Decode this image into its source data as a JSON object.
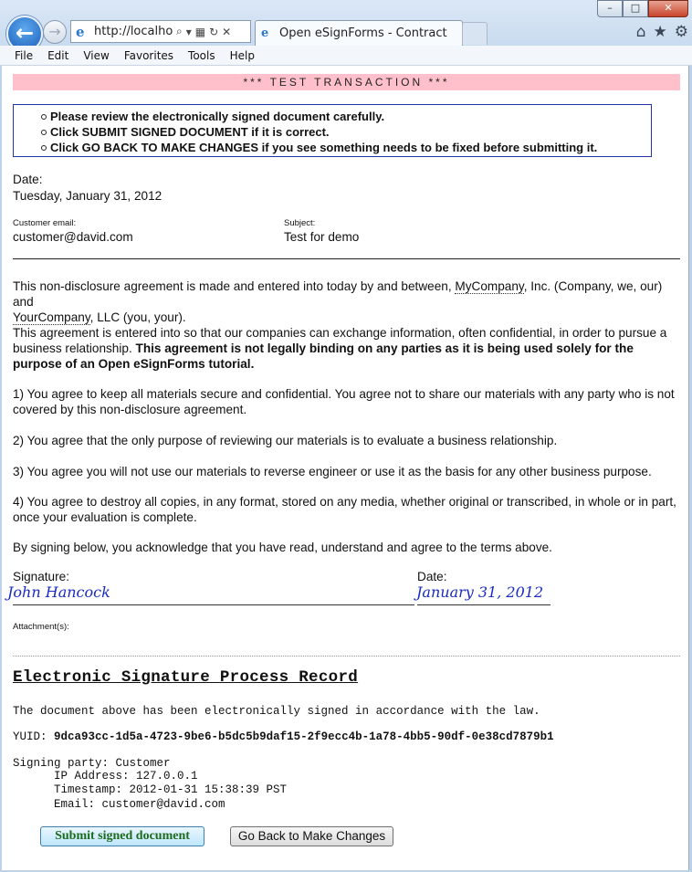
{
  "browser": {
    "address_url": "http://localhost",
    "tab_title": "Open eSignForms - Contract",
    "menu": [
      "File",
      "Edit",
      "View",
      "Favorites",
      "Tools",
      "Help"
    ],
    "window_buttons": {
      "minimize": "–",
      "maximize": "□",
      "close": "✕"
    },
    "icons": {
      "back": "←",
      "forward": "→",
      "search": "⌕",
      "dropdown": "▾",
      "compat": "▦",
      "refresh": "↻",
      "stop": "✕",
      "home": "⌂",
      "favorites": "★",
      "tools": "⚙",
      "ie": "e"
    }
  },
  "banner": "*** TEST TRANSACTION ***",
  "instructions": [
    "Please review the electronically signed document carefully.",
    "Click SUBMIT SIGNED DOCUMENT if it is correct.",
    "Click GO BACK TO MAKE CHANGES if you see something needs to be fixed before submitting it."
  ],
  "date": {
    "label": "Date:",
    "value": "Tuesday, January 31, 2012"
  },
  "customer_email": {
    "label": "Customer email:",
    "value": "customer@david.com"
  },
  "subject": {
    "label": "Subject:",
    "value": "Test for demo"
  },
  "agreement": {
    "intro_1": "This non-disclosure agreement is made and entered into today by and between, ",
    "company": "MyCompany",
    "intro_2": ", Inc. (Company, we, our) and",
    "other_company": "YourCompany",
    "intro_3": ", LLC (you, your).",
    "purpose_1": "This agreement is entered into so that our companies can exchange information, often confidential, in order to pursue a business relationship. ",
    "purpose_bold": "This agreement is not legally binding on any parties as it is being used solely for the purpose of an Open eSignForms tutorial.",
    "clauses": [
      "1) You agree to keep all materials secure and confidential. You agree not to share our materials with any party who is not covered by this non-disclosure agreement.",
      "2) You agree that the only purpose of reviewing our materials is to evaluate a business relationship.",
      "3) You agree you will not use our materials to reverse engineer or use it as the basis for any other business purpose.",
      "4) You agree to destroy all copies, in any format, stored on any media, whether original or transcribed, in whole or in part, once your evaluation is complete."
    ],
    "acknowledge": "By signing below, you acknowledge that you have read, understand and agree to the terms above."
  },
  "signature": {
    "label": "Signature:",
    "value": "John Hancock"
  },
  "signature_date": {
    "label": "Date:",
    "value": "January 31, 2012"
  },
  "attachments_label": "Attachment(s):",
  "process_record": {
    "title": "Electronic Signature Process Record",
    "statement": "The document above has been electronically signed in accordance with the law.",
    "yuid_label": "YUID:",
    "yuid": "9dca93cc-1d5a-4723-9be6-b5dc5b9daf15-2f9ecc4b-1a78-4bb5-90df-0e38cd7879b1",
    "signing_party_label": "Signing party:",
    "signing_party": "Customer",
    "ip_label": "IP Address:",
    "ip": "127.0.0.1",
    "timestamp_label": "Timestamp:",
    "timestamp": "2012-01-31 15:38:39 PST",
    "email_label": "Email:",
    "email": "customer@david.com"
  },
  "buttons": {
    "submit": "Submit signed document",
    "go_back": "Go Back to Make Changes"
  }
}
